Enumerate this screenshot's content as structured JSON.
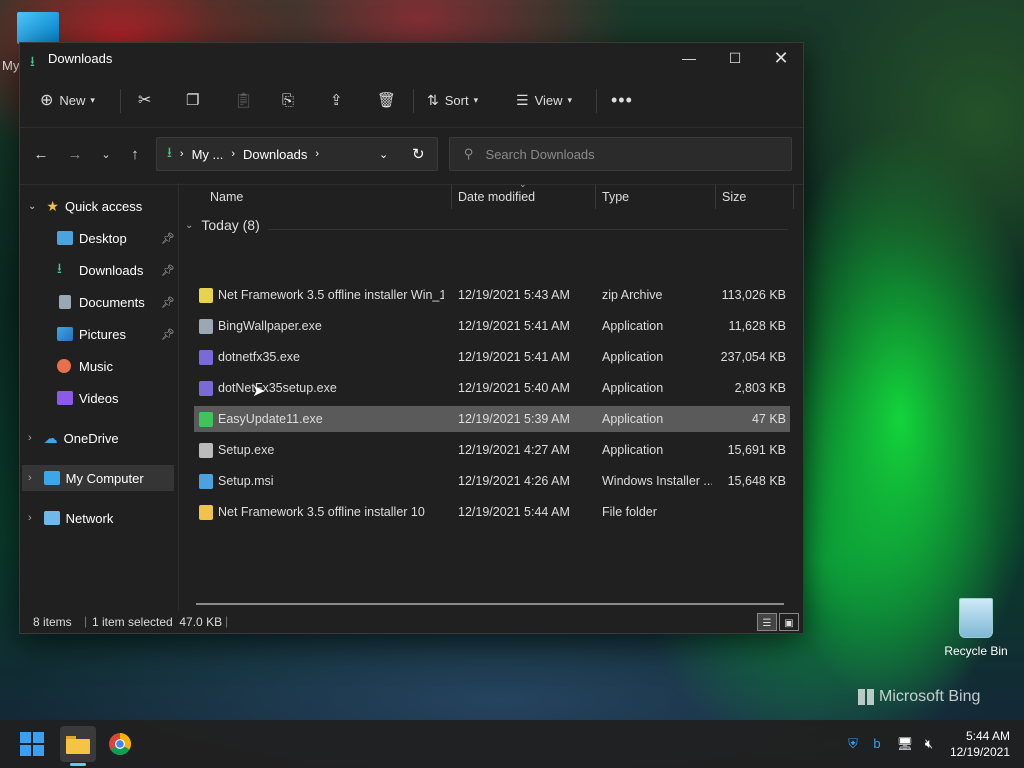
{
  "desktop": {
    "top_left_label": "My",
    "recycle_bin_label": "Recycle Bin",
    "bing_watermark": "Microsoft Bing"
  },
  "window": {
    "title": "Downloads"
  },
  "toolbar": {
    "new_label": "New",
    "sort_label": "Sort",
    "view_label": "View"
  },
  "address": {
    "crumb1": "My ...",
    "crumb2": "Downloads"
  },
  "search": {
    "placeholder": "Search Downloads"
  },
  "sidebar": {
    "quick_access": "Quick access",
    "items": [
      {
        "label": "Desktop",
        "color": "#4aa3df"
      },
      {
        "label": "Downloads",
        "color": "#4cc38a"
      },
      {
        "label": "Documents",
        "color": "#9aa7b5"
      },
      {
        "label": "Pictures",
        "color": "#3ba7e8"
      },
      {
        "label": "Music",
        "color": "#e8704c"
      },
      {
        "label": "Videos",
        "color": "#8c5ae8"
      }
    ],
    "onedrive": "OneDrive",
    "my_computer": "My Computer",
    "network": "Network"
  },
  "columns": {
    "name": "Name",
    "date": "Date modified",
    "type": "Type",
    "size": "Size"
  },
  "group_label": "Today (8)",
  "files": [
    {
      "name": "Net Framework 3.5 offline installer Win_1...",
      "date": "12/19/2021 5:43 AM",
      "type": "zip Archive",
      "size": "113,026 KB",
      "icon": "zip-icon",
      "color": "#e8d44c"
    },
    {
      "name": "BingWallpaper.exe",
      "date": "12/19/2021 5:41 AM",
      "type": "Application",
      "size": "11,628 KB",
      "icon": "exe-icon",
      "color": "#9aa7b5"
    },
    {
      "name": "dotnetfx35.exe",
      "date": "12/19/2021 5:41 AM",
      "type": "Application",
      "size": "237,054 KB",
      "icon": "exe-icon",
      "color": "#7a6ad8"
    },
    {
      "name": "dotNetFx35setup.exe",
      "date": "12/19/2021 5:40 AM",
      "type": "Application",
      "size": "2,803 KB",
      "icon": "exe-icon",
      "color": "#7a6ad8"
    },
    {
      "name": "EasyUpdate11.exe",
      "date": "12/19/2021 5:39 AM",
      "type": "Application",
      "size": "47 KB",
      "icon": "exe-icon",
      "color": "#3ec45a"
    },
    {
      "name": "Setup.exe",
      "date": "12/19/2021 4:27 AM",
      "type": "Application",
      "size": "15,691 KB",
      "icon": "exe-icon",
      "color": "#bbbbbb"
    },
    {
      "name": "Setup.msi",
      "date": "12/19/2021 4:26 AM",
      "type": "Windows Installer ...",
      "size": "15,648 KB",
      "icon": "msi-icon",
      "color": "#4aa3df"
    },
    {
      "name": "Net Framework 3.5 offline installer 10",
      "date": "12/19/2021 5:44 AM",
      "type": "File folder",
      "size": "",
      "icon": "folder-icon",
      "color": "#f0c24a"
    }
  ],
  "status": {
    "count": "8 items",
    "selection": "1 item selected  47.0 KB"
  },
  "clock": {
    "time": "5:44 AM",
    "date": "12/19/2021"
  }
}
